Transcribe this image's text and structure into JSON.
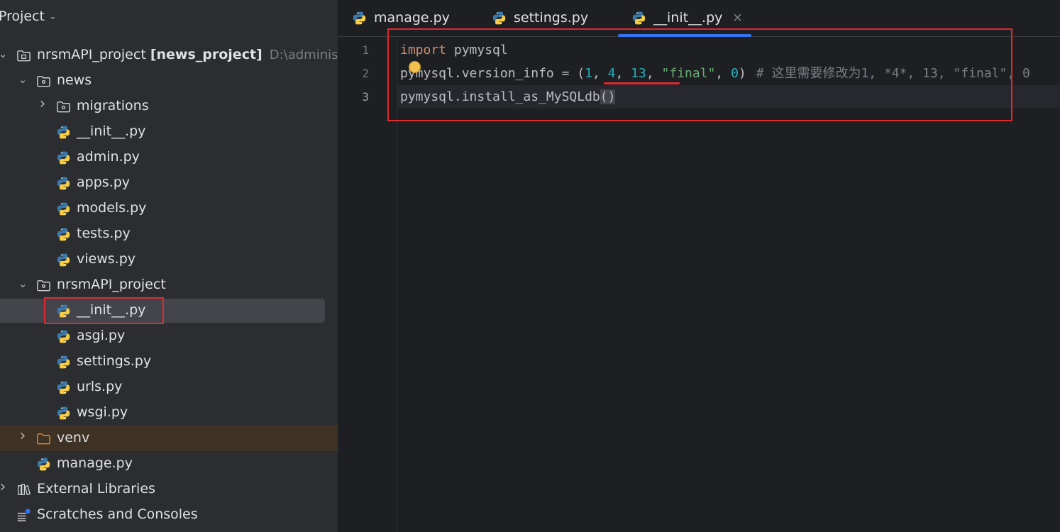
{
  "project_panel": {
    "title": "Project",
    "tree": [
      {
        "label": "nrsmAPI_project",
        "bold_suffix": "[news_project]",
        "path_hint": "D:\\administr",
        "kind": "module",
        "arrow": "expanded"
      },
      {
        "label": "news",
        "kind": "package",
        "arrow": "expanded"
      },
      {
        "label": "migrations",
        "kind": "package",
        "arrow": "collapsed"
      },
      {
        "label": "__init__.py",
        "kind": "python"
      },
      {
        "label": "admin.py",
        "kind": "python"
      },
      {
        "label": "apps.py",
        "kind": "python"
      },
      {
        "label": "models.py",
        "kind": "python"
      },
      {
        "label": "tests.py",
        "kind": "python"
      },
      {
        "label": "views.py",
        "kind": "python"
      },
      {
        "label": "nrsmAPI_project",
        "kind": "package",
        "arrow": "expanded"
      },
      {
        "label": "__init__.py",
        "kind": "python",
        "selected": true
      },
      {
        "label": "asgi.py",
        "kind": "python"
      },
      {
        "label": "settings.py",
        "kind": "python"
      },
      {
        "label": "urls.py",
        "kind": "python"
      },
      {
        "label": "wsgi.py",
        "kind": "python"
      },
      {
        "label": "venv",
        "kind": "excluded-folder",
        "arrow": "collapsed"
      },
      {
        "label": "manage.py",
        "kind": "python"
      },
      {
        "label": "External Libraries",
        "kind": "libraries",
        "arrow": "collapsed"
      },
      {
        "label": "Scratches and Consoles",
        "kind": "scratches"
      }
    ]
  },
  "editor": {
    "tabs": [
      {
        "label": "manage.py",
        "active": false
      },
      {
        "label": "settings.py",
        "active": false
      },
      {
        "label": "__init__.py",
        "active": true,
        "close_glyph": "×"
      }
    ],
    "line_numbers": [
      "1",
      "2",
      "3"
    ],
    "code": {
      "line1": {
        "kw": "import",
        "rest": " pymysql"
      },
      "line2": {
        "t1": "pymysql.version_info = (",
        "n1": "1",
        "c1": ", ",
        "n2": "4",
        "c2": ", ",
        "n3": "13",
        "c3": ", ",
        "s1": "\"final\"",
        "c4": ", ",
        "n4": "0",
        "t2": ")",
        "comment": "# 这里需要修改为1, *4*, 13, \"final\", 0"
      },
      "line3": {
        "t1": "pymysql.install_as_MySQLdb",
        "paren": "()"
      }
    }
  },
  "colors": {
    "annotation_red": "#e0282f",
    "accent_blue": "#3574f0",
    "keyword": "#cf8e6d",
    "number": "#2aacb8",
    "string": "#6aab73",
    "comment": "#7a7e85"
  }
}
